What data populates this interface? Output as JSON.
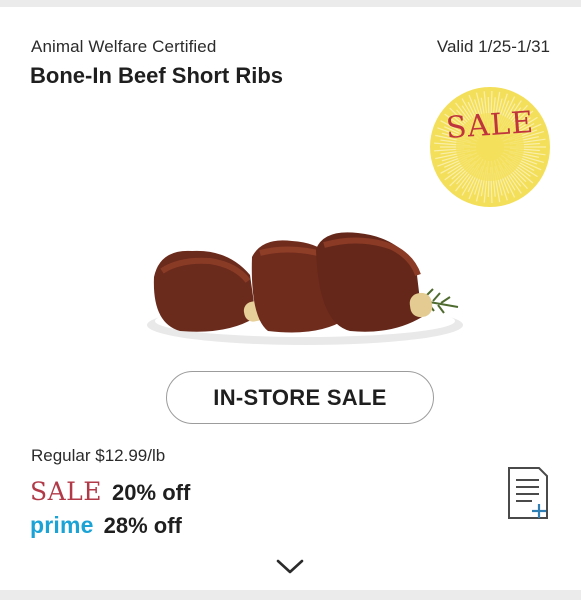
{
  "deal": {
    "certification": "Animal Welfare Certified",
    "title": "Bone-In Beef Short Ribs",
    "valid": "Valid 1/25-1/31",
    "badge_text": "SALE",
    "badge_color": "#f3df5a",
    "cta_label": "IN-STORE SALE",
    "regular_price": "Regular $12.99/lb",
    "sale_label": "SALE",
    "sale_discount": "20% off",
    "prime_label": "prime",
    "prime_discount": "28% off"
  },
  "icons": {
    "add_to_list": "add-to-list-icon",
    "expand": "chevron-down-icon",
    "badge": "sunburst-badge-icon"
  },
  "colors": {
    "sale_red": "#b23a48",
    "prime_blue": "#1ba3d6",
    "badge_yellow": "#f3df5a"
  }
}
